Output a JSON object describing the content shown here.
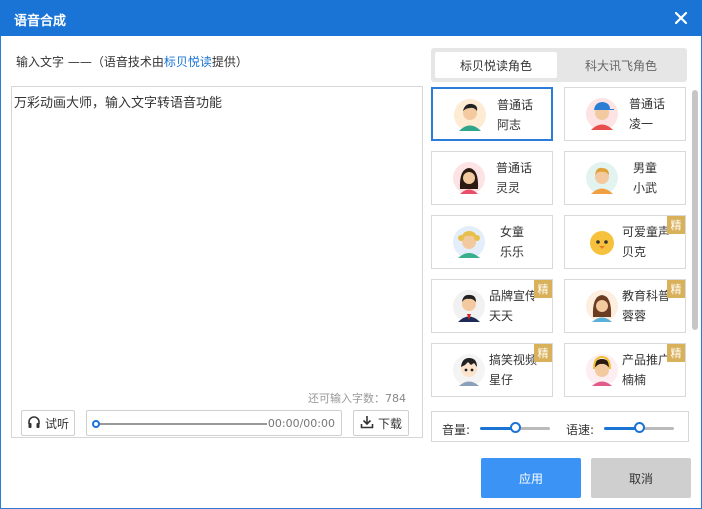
{
  "window": {
    "title": "语音合成"
  },
  "input": {
    "label_prefix": "输入文字 ——（语音技术由",
    "label_link": "标贝悦读",
    "label_suffix": "提供）",
    "text": "万彩动画大师，输入文字转语音功能",
    "remaining_label": "还可输入字数：",
    "remaining_count": "784"
  },
  "player": {
    "listen_label": "试听",
    "time": "00:00/00:00",
    "download_label": "下载"
  },
  "tabs": [
    {
      "label": "标贝悦读角色",
      "active": true
    },
    {
      "label": "科大讯飞角色",
      "active": false
    }
  ],
  "voices": [
    {
      "line1": "普通话",
      "line2": "阿志",
      "selected": true,
      "premium": false,
      "avatar": "man-teal-shirt-avatar"
    },
    {
      "line1": "普通话",
      "line2": "凌一",
      "selected": false,
      "premium": false,
      "avatar": "boy-cap-avatar"
    },
    {
      "line1": "普通话",
      "line2": "灵灵",
      "selected": false,
      "premium": false,
      "avatar": "woman-longhair-avatar"
    },
    {
      "line1": "男童",
      "line2": "小武",
      "selected": false,
      "premium": false,
      "avatar": "boy-child-avatar"
    },
    {
      "line1": "女童",
      "line2": "乐乐",
      "selected": false,
      "premium": false,
      "avatar": "girl-child-avatar"
    },
    {
      "line1": "可爱童声",
      "line2": "贝克",
      "selected": false,
      "premium": true,
      "avatar": "chick-mascot-avatar"
    },
    {
      "line1": "品牌宣传",
      "line2": "天天",
      "selected": false,
      "premium": true,
      "avatar": "man-suit-avatar"
    },
    {
      "line1": "教育科普",
      "line2": "蓉蓉",
      "selected": false,
      "premium": true,
      "avatar": "woman-teacher-avatar"
    },
    {
      "line1": "搞笑视频",
      "line2": "星仔",
      "selected": false,
      "premium": true,
      "avatar": "cartoon-man-avatar"
    },
    {
      "line1": "产品推广",
      "line2": "楠楠",
      "selected": false,
      "premium": true,
      "avatar": "woman-headset-avatar"
    }
  ],
  "premium_badge": "精",
  "controls": {
    "volume_label": "音量:",
    "volume_level": 0.5,
    "speed_label": "语速:",
    "speed_level": 0.5
  },
  "buttons": {
    "apply": "应用",
    "cancel": "取消"
  },
  "colors": {
    "accent": "#1a74d6",
    "apply_bg": "#3b93f5",
    "badge": "#d9b15a"
  }
}
